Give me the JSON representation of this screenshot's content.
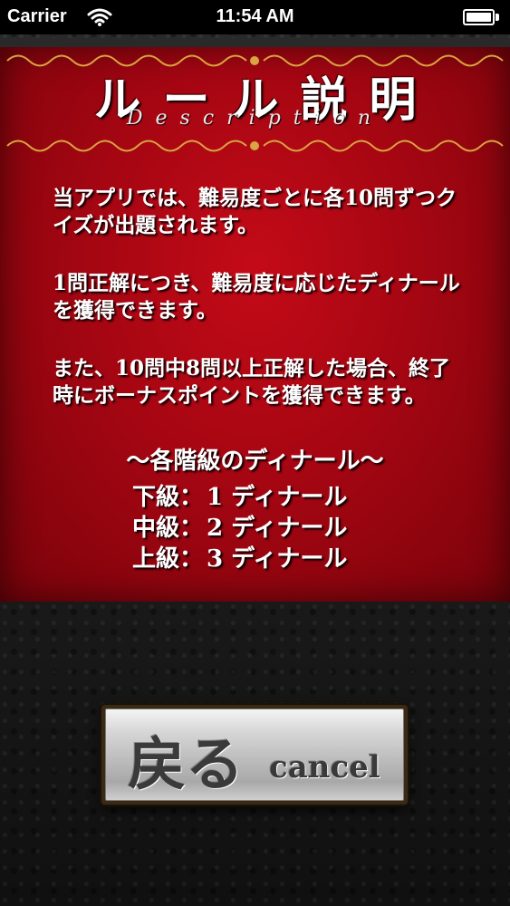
{
  "status_bar": {
    "carrier": "Carrier",
    "time": "11:54 AM"
  },
  "rules": {
    "title": "ルール説明",
    "subtitle": "Description",
    "paragraphs": [
      "当アプリでは、難易度ごとに各10問ずつクイズが出題されます。",
      "1問正解につき、難易度に応じたディナールを獲得できます。",
      "また、10問中8問以上正解した場合、終了時にボーナスポイントを獲得できます。"
    ],
    "ranks_heading": "〜各階級のディナール〜",
    "ranks": [
      {
        "label": "下級",
        "points": "1 ディナール"
      },
      {
        "label": "中級",
        "points": "2 ディナール"
      },
      {
        "label": "上級",
        "points": "3 ディナール"
      }
    ]
  },
  "back_button": {
    "label": "戻る",
    "sub_label": "cancel"
  },
  "colors": {
    "panel_red": "#a50612",
    "ornament_gold": "#d9a441",
    "background_dark": "#1b1b1b"
  },
  "icons": [
    "wifi-icon",
    "battery-icon",
    "ornament-icon"
  ]
}
